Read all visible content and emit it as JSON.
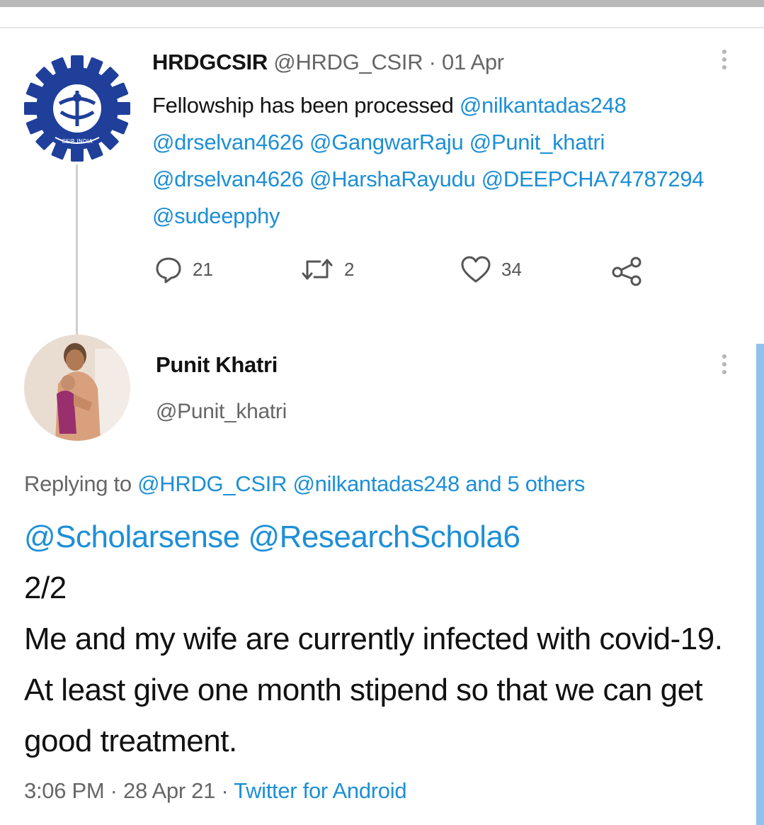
{
  "parent_tweet": {
    "author_name": "HRDGCSIR",
    "handle": "@HRDG_CSIR",
    "separator": " · ",
    "date": "01 Apr",
    "text_lead": "Fellowship has been processed ",
    "mentions": [
      "@nilkantadas248",
      "@drselvan4626",
      "@GangwarRaju",
      "@Punit_khatri",
      "@drselvan4626",
      "@HarshaRayudu",
      "@DEEPCHA74787294",
      "@sudeepphy"
    ],
    "logo_icon": "csir-logo-icon",
    "logo_text": "CSIR INDIA",
    "actions": {
      "reply_count": "21",
      "retweet_count": "2",
      "like_count": "34",
      "reply_icon": "comment-icon",
      "retweet_icon": "retweet-icon",
      "like_icon": "heart-icon",
      "share_icon": "share-icon"
    }
  },
  "reply_tweet": {
    "author_name": "Punit Khatri",
    "handle": "@Punit_khatri",
    "replying_prefix": "Replying to ",
    "replying_mentions": "@HRDG_CSIR @nilkantadas248",
    "replying_suffix": " and 5 others",
    "mentions_line": "@Scholarsense @ResearchSchola6",
    "line_part": "2/2",
    "body": "Me and my wife are currently infected with covid-19. At least give one month stipend so that we can get good treatment.",
    "time": "3:06 PM",
    "separator": " · ",
    "date": "28 Apr 21",
    "separator2": " · ",
    "source": "Twitter for Android"
  },
  "colors": {
    "link": "#1d8fd6",
    "secondary_text": "#666666",
    "accent_bar": "#8fc3ee",
    "csir_blue": "#1f3f9a"
  }
}
